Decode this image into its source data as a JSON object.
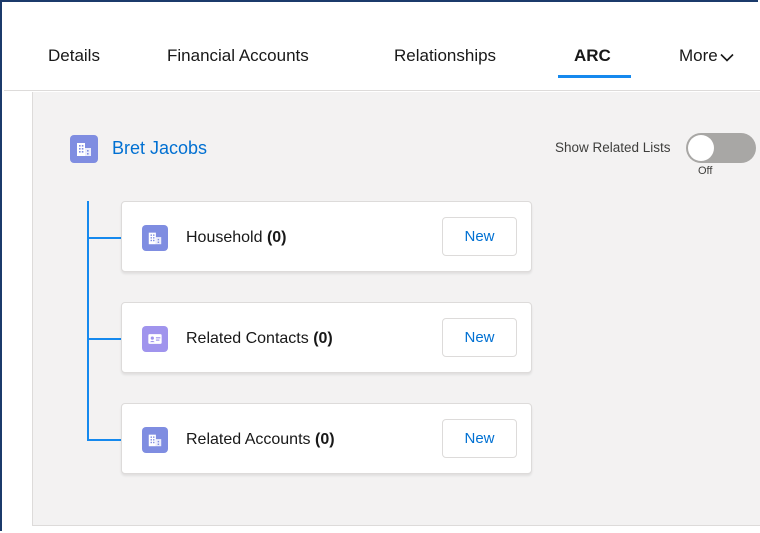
{
  "tabs": [
    {
      "label": "Details",
      "active": false
    },
    {
      "label": "Financial Accounts",
      "active": false
    },
    {
      "label": "Relationships",
      "active": false
    },
    {
      "label": "ARC",
      "active": true
    },
    {
      "label": "More",
      "active": false
    }
  ],
  "more_icon": "chevron-down-icon",
  "root": {
    "name": "Bret Jacobs",
    "icon": "account-icon",
    "icon_color": "#7f8de1"
  },
  "toggle": {
    "label": "Show Related Lists",
    "state_label": "Off",
    "on": false
  },
  "related_lists": [
    {
      "title": "Household",
      "count": "(0)",
      "button": "New",
      "icon": "account-icon",
      "icon_color": "#7f8de1"
    },
    {
      "title": "Related Contacts",
      "count": "(0)",
      "button": "New",
      "icon": "contact-icon",
      "icon_color": "#a094ed"
    },
    {
      "title": "Related Accounts",
      "count": "(0)",
      "button": "New",
      "icon": "account-icon",
      "icon_color": "#7f8de1"
    }
  ],
  "colors": {
    "accent": "#1589ee",
    "link": "#0070d2",
    "panel_bg": "#f3f2f2"
  }
}
